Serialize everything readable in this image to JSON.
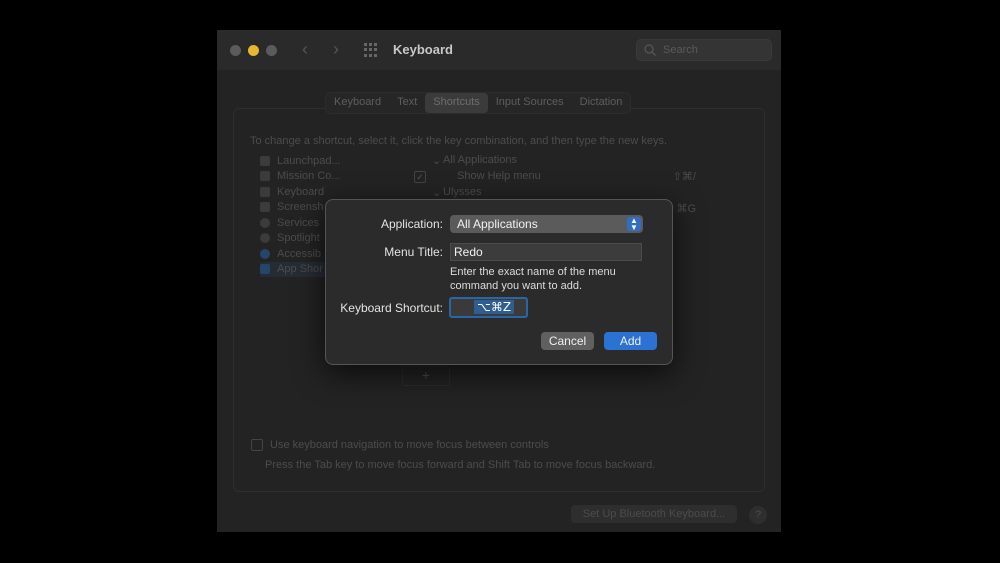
{
  "window": {
    "title": "Keyboard"
  },
  "search": {
    "placeholder": "Search"
  },
  "tabs": [
    {
      "label": "Keyboard"
    },
    {
      "label": "Text"
    },
    {
      "label": "Shortcuts",
      "selected": true
    },
    {
      "label": "Input Sources"
    },
    {
      "label": "Dictation"
    }
  ],
  "instructions": "To change a shortcut, select it, click the key combination, and then type the new keys.",
  "categories": [
    {
      "label": "Launchpad..."
    },
    {
      "label": "Mission Co..."
    },
    {
      "label": "Keyboard"
    },
    {
      "label": "Screensh"
    },
    {
      "label": "Services"
    },
    {
      "label": "Spotlight"
    },
    {
      "label": "Accessib"
    },
    {
      "label": "App Shor",
      "selected": true
    }
  ],
  "shortcut_tree": {
    "group1": "All Applications",
    "item1": {
      "label": "Show Help menu",
      "checked": true,
      "keys": "⇧⌘/"
    },
    "group2": "Ulysses",
    "item2_keys": "⌘G"
  },
  "add_remove": {
    "add": "+",
    "remove": "−"
  },
  "keyboard_nav": {
    "label": "Use keyboard navigation to move focus between controls",
    "description": "Press the Tab key to move focus forward and Shift Tab to move focus backward."
  },
  "bluetooth_button": "Set Up Bluetooth Keyboard...",
  "help_button": "?",
  "dialog": {
    "application_label": "Application:",
    "application_value": "All Applications",
    "menu_title_label": "Menu Title:",
    "menu_title_value": "Redo",
    "help_text": "Enter the exact name of the menu command you want to add.",
    "shortcut_label": "Keyboard Shortcut:",
    "shortcut_value": "⌥⌘Z",
    "cancel_label": "Cancel",
    "add_label": "Add"
  },
  "colors": {
    "accent": "#2c72d3",
    "window_bg": "#232323"
  }
}
